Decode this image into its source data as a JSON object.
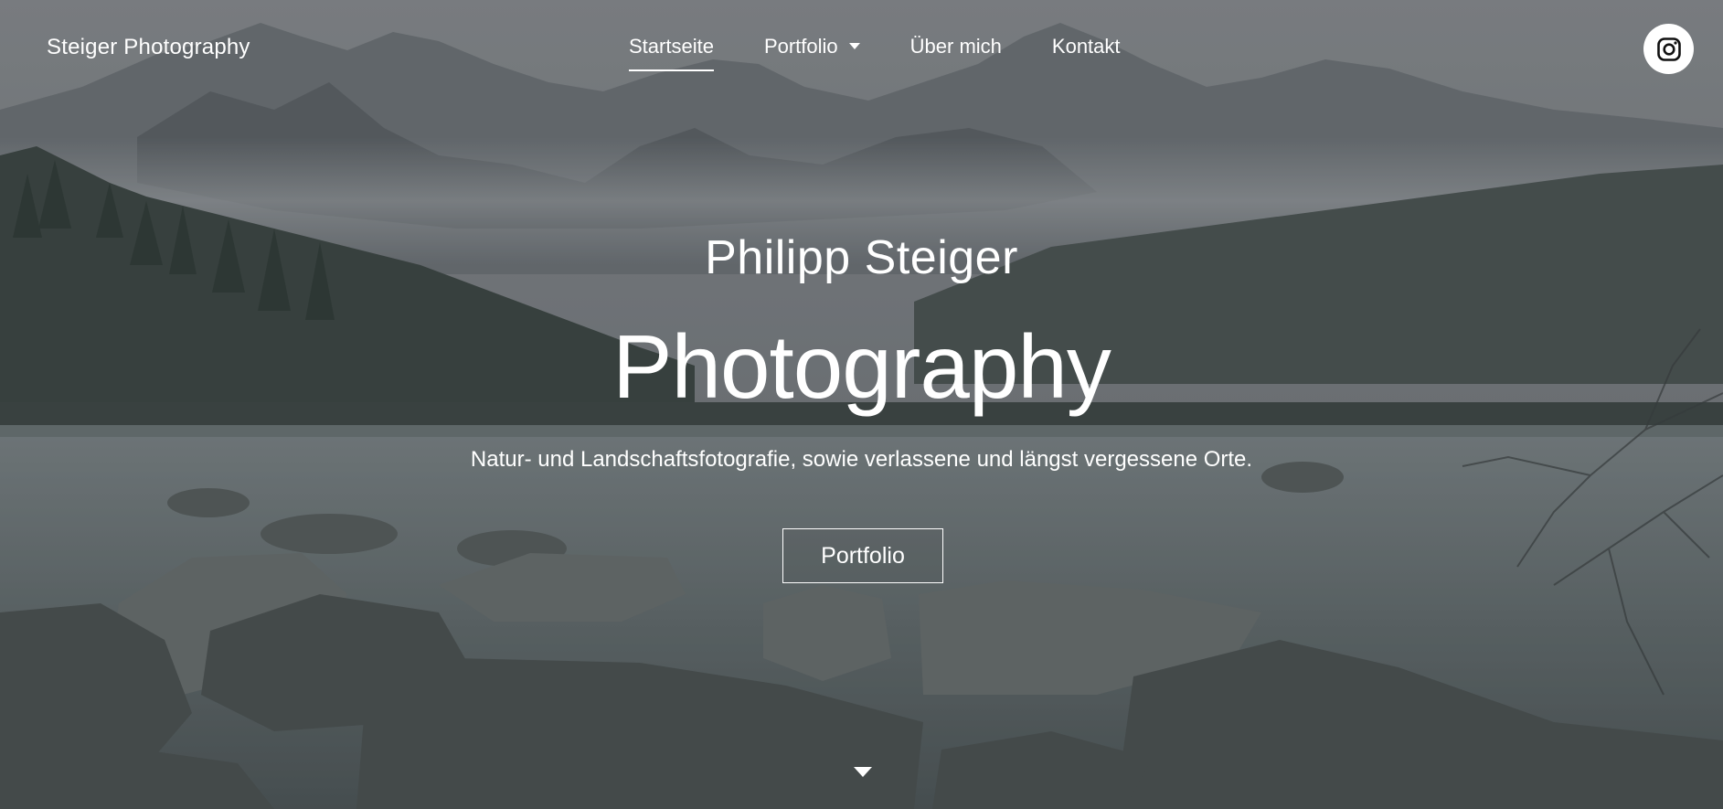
{
  "header": {
    "brand": "Steiger Photography",
    "nav": [
      {
        "label": "Startseite",
        "active": true
      },
      {
        "label": "Portfolio",
        "has_dropdown": true
      },
      {
        "label": "Über mich"
      },
      {
        "label": "Kontakt"
      }
    ],
    "social_icon": "instagram-icon"
  },
  "hero": {
    "name": "Philipp Steiger",
    "title": "Photography",
    "subtitle": "Natur- und Landschaftsfotografie, sowie verlassene und längst vergessene Orte.",
    "cta_label": "Portfolio",
    "scroll_icon": "caret-down-icon"
  },
  "colors": {
    "text": "#ffffff",
    "active_underline": "#ffffff"
  }
}
